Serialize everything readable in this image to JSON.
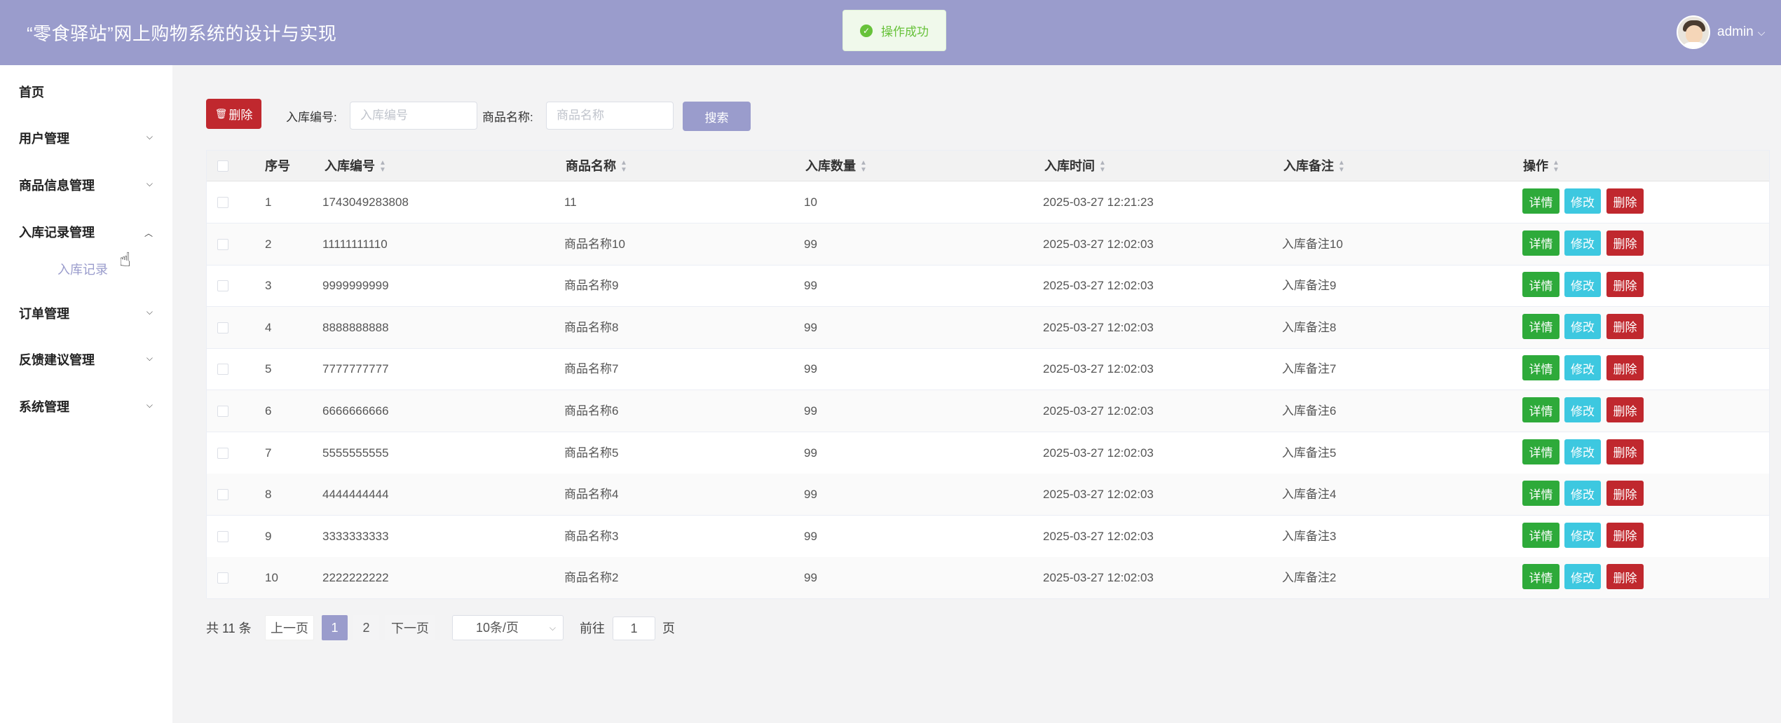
{
  "header": {
    "title": "“零食驿站”网上购物系统的设计与实现",
    "toast": "操作成功",
    "user": "admin"
  },
  "sidebar": {
    "items": [
      {
        "label": "首页"
      },
      {
        "label": "用户管理"
      },
      {
        "label": "商品信息管理"
      },
      {
        "label": "入库记录管理"
      },
      {
        "label": "订单管理"
      },
      {
        "label": "反馈建议管理"
      },
      {
        "label": "系统管理"
      }
    ],
    "active_sub": "入库记录"
  },
  "toolbar": {
    "delete_label": "删除",
    "code_label": "入库编号:",
    "code_placeholder": "入库编号",
    "name_label": "商品名称:",
    "name_placeholder": "商品名称",
    "search_label": "搜索"
  },
  "table": {
    "columns": [
      "序号",
      "入库编号",
      "商品名称",
      "入库数量",
      "入库时间",
      "入库备注",
      "操作"
    ],
    "actions": {
      "detail": "详情",
      "edit": "修改",
      "delete": "删除"
    },
    "rows": [
      {
        "index": "1",
        "code": "1743049283808",
        "name": "11",
        "qty": "10",
        "time": "2025-03-27 12:21:23",
        "note": ""
      },
      {
        "index": "2",
        "code": "11111111110",
        "name": "商品名称10",
        "qty": "99",
        "time": "2025-03-27 12:02:03",
        "note": "入库备注10"
      },
      {
        "index": "3",
        "code": "9999999999",
        "name": "商品名称9",
        "qty": "99",
        "time": "2025-03-27 12:02:03",
        "note": "入库备注9"
      },
      {
        "index": "4",
        "code": "8888888888",
        "name": "商品名称8",
        "qty": "99",
        "time": "2025-03-27 12:02:03",
        "note": "入库备注8"
      },
      {
        "index": "5",
        "code": "7777777777",
        "name": "商品名称7",
        "qty": "99",
        "time": "2025-03-27 12:02:03",
        "note": "入库备注7"
      },
      {
        "index": "6",
        "code": "6666666666",
        "name": "商品名称6",
        "qty": "99",
        "time": "2025-03-27 12:02:03",
        "note": "入库备注6"
      },
      {
        "index": "7",
        "code": "5555555555",
        "name": "商品名称5",
        "qty": "99",
        "time": "2025-03-27 12:02:03",
        "note": "入库备注5"
      },
      {
        "index": "8",
        "code": "4444444444",
        "name": "商品名称4",
        "qty": "99",
        "time": "2025-03-27 12:02:03",
        "note": "入库备注4"
      },
      {
        "index": "9",
        "code": "3333333333",
        "name": "商品名称3",
        "qty": "99",
        "time": "2025-03-27 12:02:03",
        "note": "入库备注3"
      },
      {
        "index": "10",
        "code": "2222222222",
        "name": "商品名称2",
        "qty": "99",
        "time": "2025-03-27 12:02:03",
        "note": "入库备注2"
      }
    ]
  },
  "pagination": {
    "total": "共 11 条",
    "prev": "上一页",
    "pages": [
      "1",
      "2"
    ],
    "current": "1",
    "next": "下一页",
    "page_size": "10条/页",
    "goto_label": "前往",
    "goto_value": "1",
    "goto_suffix": "页"
  }
}
